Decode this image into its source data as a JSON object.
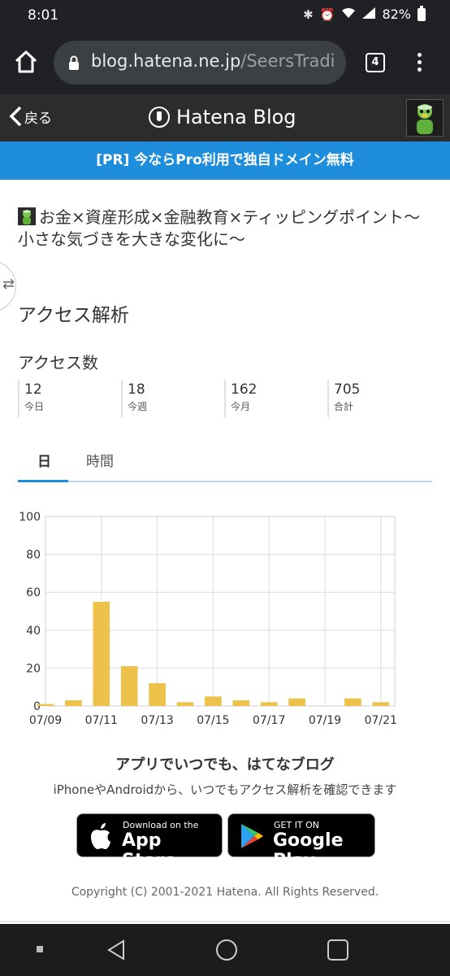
{
  "status_bar": {
    "time": "8:01",
    "battery": "82%"
  },
  "browser": {
    "url_host": "blog.hatena.ne.jp",
    "url_rest": "/SeersTradi",
    "tab_count": "4"
  },
  "header": {
    "back_label": "戻る",
    "logo_text": "Hatena Blog"
  },
  "promo": {
    "text": "[PR] 今ならPro利用で独自ドメイン無料"
  },
  "blog": {
    "title": "お金×資産形成×金融教育×ティッピングポイント〜小さな気づきを大きな変化に〜"
  },
  "page": {
    "section_title": "アクセス解析",
    "access_count_label": "アクセス数"
  },
  "stats": [
    {
      "value": "12",
      "label": "今日"
    },
    {
      "value": "18",
      "label": "今週"
    },
    {
      "value": "162",
      "label": "今月"
    },
    {
      "value": "705",
      "label": "合計"
    }
  ],
  "tabs": [
    {
      "label": "日",
      "active": true
    },
    {
      "label": "時間",
      "active": false
    }
  ],
  "chart_data": {
    "type": "bar",
    "categories": [
      "07/09",
      "07/10",
      "07/11",
      "07/12",
      "07/13",
      "07/14",
      "07/15",
      "07/16",
      "07/17",
      "07/18",
      "07/19",
      "07/20",
      "07/21"
    ],
    "values": [
      1,
      3,
      55,
      21,
      12,
      2,
      5,
      3,
      2,
      4,
      0,
      4,
      2
    ],
    "x_tick_labels": [
      "07/09",
      "07/11",
      "07/13",
      "07/15",
      "07/17",
      "07/19",
      "07/21"
    ],
    "y_ticks": [
      0,
      20,
      40,
      60,
      80,
      100
    ],
    "ylim": [
      0,
      100
    ],
    "grid": true,
    "bar_color": "#ecc24a"
  },
  "app_promo": {
    "title": "アプリでいつでも、はてなブログ",
    "subtitle": "iPhoneやAndroidから、いつでもアクセス解析を確認できます",
    "apple_small": "Download on the",
    "apple_big": "App Store",
    "google_small": "GET IT ON",
    "google_big": "Google Play"
  },
  "footer": {
    "copyright": "Copyright (C) 2001-2021 Hatena. All Rights Reserved."
  },
  "colors": {
    "accent": "#1e8ddb",
    "header_bg": "#2c2c2c",
    "bar": "#ecc24a"
  }
}
